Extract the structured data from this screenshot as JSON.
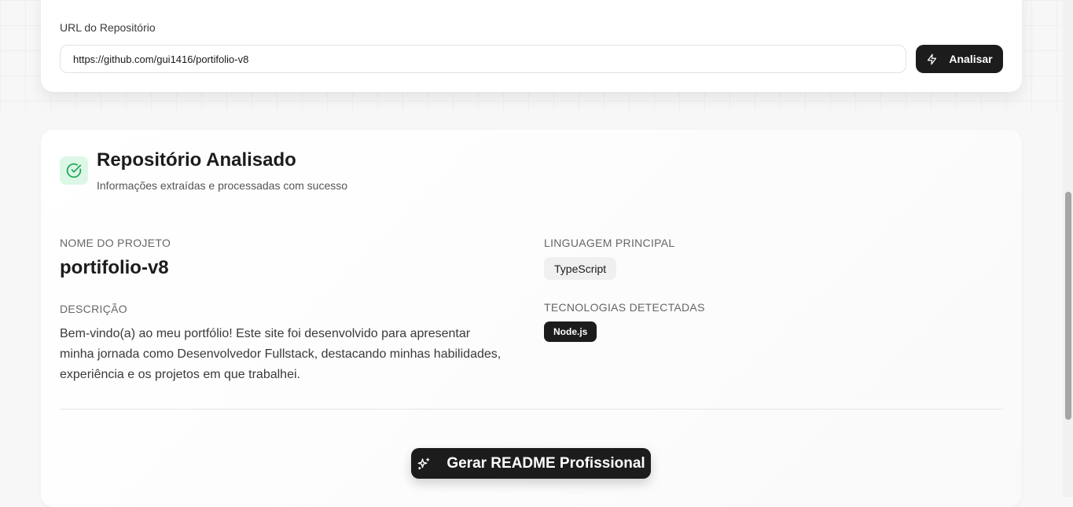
{
  "analyze_section": {
    "url_label": "URL do Repositório",
    "url_value": "https://github.com/gui1416/portifolio-v8",
    "analyze_button": "Analisar",
    "analyze_icon": "lightning-icon"
  },
  "result": {
    "title": "Repositório Analisado",
    "subtitle": "Informações extraídas e processadas com sucesso",
    "status_icon": "check-circle-icon",
    "status_color": "#16a34a",
    "project_name_label": "NOME DO PROJETO",
    "project_name": "portifolio-v8",
    "description_label": "DESCRIÇÃO",
    "description": "Bem-vindo(a) ao meu portfólio! Este site foi desenvolvido para apresentar minha jornada como Desenvolvedor Fullstack, destacando minhas habilidades, experiência e os projetos em que trabalhei.",
    "language_label": "LINGUAGEM PRINCIPAL",
    "language": "TypeScript",
    "technologies_label": "TECNOLOGIAS DETECTADAS",
    "technologies": [
      "Node.js"
    ],
    "generate_button": "Gerar README Profissional",
    "generate_icon": "sparkles-icon"
  },
  "colors": {
    "primary": "#1c1c1c",
    "success_bg": "#dcf7e6",
    "page_bg": "#f7f7f7"
  }
}
